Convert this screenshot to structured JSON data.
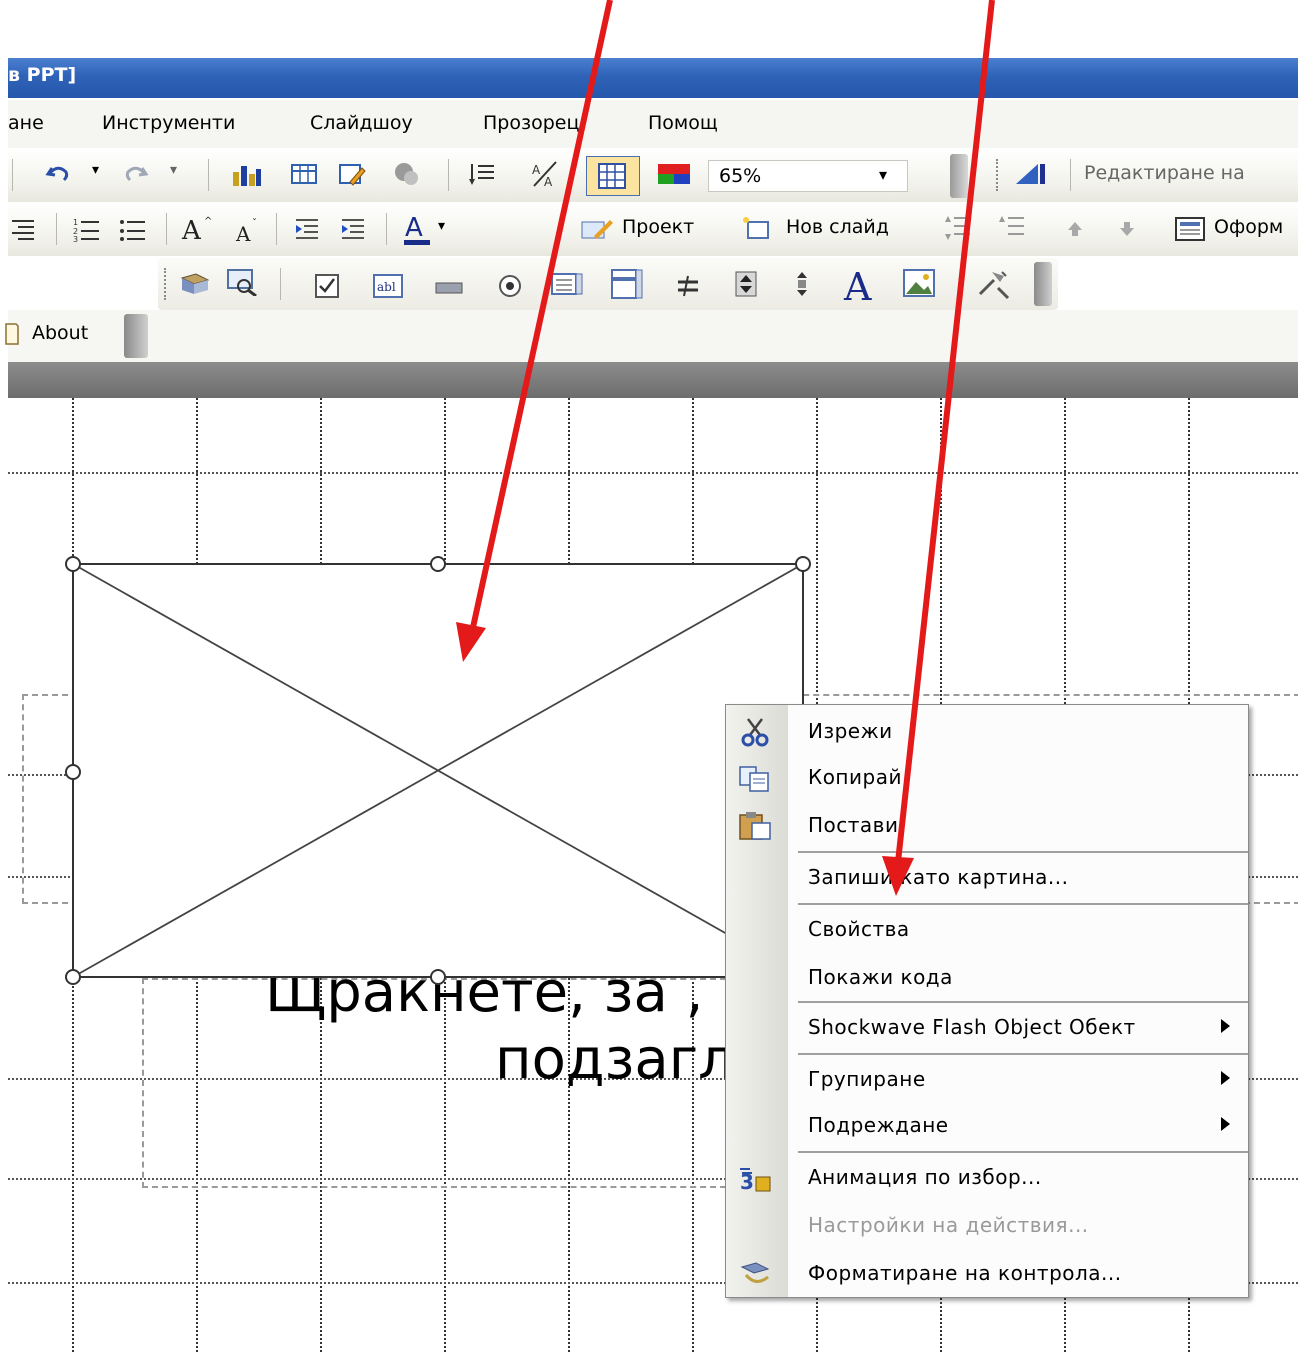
{
  "window": {
    "title_fragment": "в PPT]"
  },
  "menu": {
    "items": [
      "ане",
      "Инструменти",
      "Слайдшоу",
      "Прозорец",
      "Помощ"
    ]
  },
  "toolbar1": {
    "zoom_value": "65%",
    "edit_label": "Редактиране на"
  },
  "toolbar2": {
    "design_label": "Проект",
    "new_slide_label": "Нов слайд",
    "format_label": "Оформ"
  },
  "toolbar4": {
    "about_label": "About"
  },
  "slide": {
    "subtitle_line1": "Щракнете, за ,",
    "subtitle_line2": "подзагл"
  },
  "context_menu": {
    "items": [
      {
        "label": "Изрежи",
        "icon": "scissors-icon",
        "enabled": true,
        "submenu": false
      },
      {
        "label": "Копирай",
        "icon": "copy-icon",
        "enabled": true,
        "submenu": false
      },
      {
        "label": "Постави",
        "icon": "paste-icon",
        "enabled": true,
        "submenu": false
      },
      {
        "label": "Запиши като картина...",
        "icon": "",
        "enabled": true,
        "submenu": false
      },
      {
        "label": "Свойства",
        "icon": "",
        "enabled": true,
        "submenu": false
      },
      {
        "label": "Покажи кода",
        "icon": "",
        "enabled": true,
        "submenu": false
      },
      {
        "label": "Shockwave Flash Object Обект",
        "icon": "",
        "enabled": true,
        "submenu": true
      },
      {
        "label": "Групиране",
        "icon": "",
        "enabled": true,
        "submenu": true
      },
      {
        "label": "Подреждане",
        "icon": "",
        "enabled": true,
        "submenu": true
      },
      {
        "label": "Анимация по избор...",
        "icon": "custom-animation-icon",
        "enabled": true,
        "submenu": false
      },
      {
        "label": "Настройки на действия...",
        "icon": "",
        "enabled": false,
        "submenu": false
      },
      {
        "label": "Форматиране на  контрола...",
        "icon": "format-control-icon",
        "enabled": true,
        "submenu": false
      }
    ]
  },
  "colors": {
    "titlebar": "#2f63b8",
    "arrow": "#e41a1a",
    "menu_bg": "#fcfcfc"
  }
}
